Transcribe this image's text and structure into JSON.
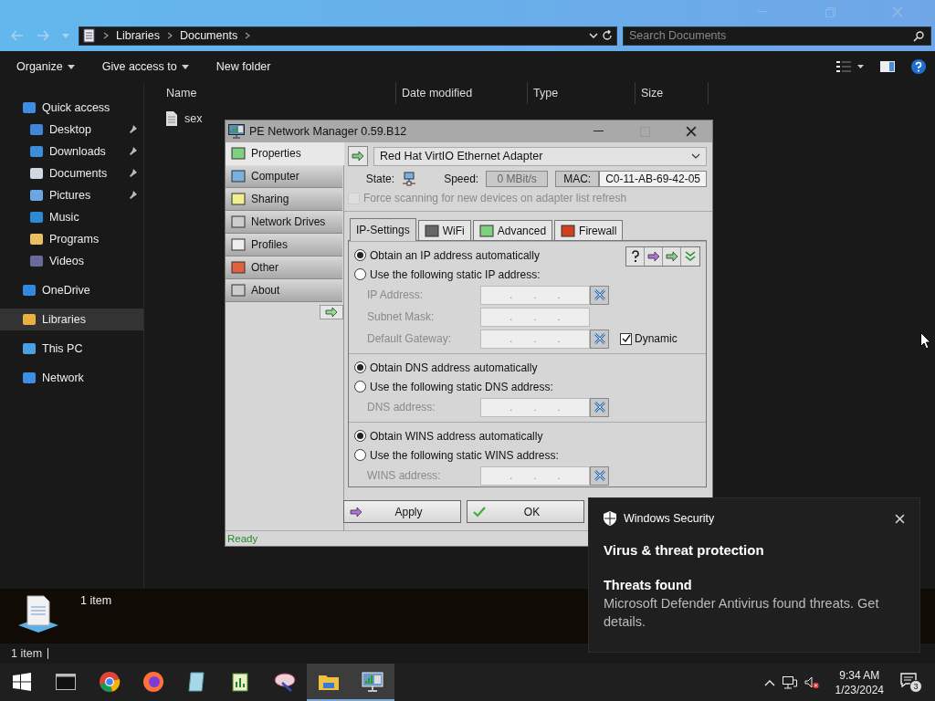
{
  "explorer": {
    "breadcrumb": [
      "Libraries",
      "Documents"
    ],
    "search": {
      "placeholder": "Search Documents"
    },
    "commands": [
      {
        "label": "Organize",
        "dropdown": true
      },
      {
        "label": "Give access to",
        "dropdown": true
      },
      {
        "label": "New folder",
        "dropdown": false
      }
    ],
    "nav_pane": [
      {
        "label": "Quick access",
        "selected": false,
        "children": [
          {
            "label": "Desktop",
            "selected": false,
            "pinned": true
          },
          {
            "label": "Downloads",
            "selected": false,
            "pinned": true
          },
          {
            "label": "Documents",
            "selected": false,
            "pinned": true
          },
          {
            "label": "Pictures",
            "selected": false,
            "pinned": true
          },
          {
            "label": "Music",
            "selected": false,
            "pinned": false
          },
          {
            "label": "Programs",
            "selected": false,
            "pinned": false
          },
          {
            "label": "Videos",
            "selected": false,
            "pinned": false
          }
        ]
      },
      {
        "label": "OneDrive",
        "selected": false
      },
      {
        "label": "Libraries",
        "selected": true
      },
      {
        "label": "This PC",
        "selected": false
      },
      {
        "label": "Network",
        "selected": false
      }
    ],
    "columns": [
      "Name",
      "Date modified",
      "Type",
      "Size"
    ],
    "files": [
      {
        "name": "sex"
      }
    ],
    "details": {
      "count": "1 item"
    },
    "status_bar": "1 item"
  },
  "dialog": {
    "title": "PE Network Manager 0.59.B12",
    "sidebar": [
      {
        "label": "Properties",
        "selected": true
      },
      {
        "label": "Computer",
        "selected": false
      },
      {
        "label": "Sharing",
        "selected": false
      },
      {
        "label": "Network Drives",
        "selected": false
      },
      {
        "label": "Profiles",
        "selected": false
      },
      {
        "label": "Other",
        "selected": false
      },
      {
        "label": "About",
        "selected": false
      }
    ],
    "adapter": "Red Hat VirtIO Ethernet Adapter",
    "state_label": "State:",
    "speed_label": "Speed:",
    "speed": "0 MBit/s",
    "mac_label": "MAC:",
    "mac": "C0-11-AB-69-42-05",
    "force_scan": {
      "label": "Force scanning for new devices on adapter list refresh",
      "checked": false,
      "disabled": true
    },
    "tabs": [
      {
        "label": "IP-Settings",
        "selected": true
      },
      {
        "label": "WiFi",
        "selected": false
      },
      {
        "label": "Advanced",
        "selected": false
      },
      {
        "label": "Firewall",
        "selected": false
      }
    ],
    "sections": [
      {
        "options": [
          {
            "label": "Obtain an IP address automatically",
            "selected": true
          },
          {
            "label": "Use the following static IP address:",
            "selected": false
          }
        ],
        "fields": [
          {
            "label": "IP Address:",
            "value": ". . .",
            "clear_button": true
          },
          {
            "label": "Subnet Mask:",
            "value": ". . .",
            "clear_button": false
          },
          {
            "label": "Default Gateway:",
            "value": ". . .",
            "clear_button": true,
            "checkbox": {
              "label": "Dynamic",
              "checked": true
            }
          }
        ]
      },
      {
        "options": [
          {
            "label": "Obtain DNS address automatically",
            "selected": true
          },
          {
            "label": "Use the following static DNS address:",
            "selected": false
          }
        ],
        "fields": [
          {
            "label": "DNS address:",
            "value": ". . .",
            "clear_button": true
          }
        ]
      },
      {
        "options": [
          {
            "label": "Obtain WINS address automatically",
            "selected": true
          },
          {
            "label": "Use the following static WINS address:",
            "selected": false
          }
        ],
        "fields": [
          {
            "label": "WINS address:",
            "value": ". . .",
            "clear_button": true
          }
        ]
      }
    ],
    "buttons": [
      "Apply",
      "OK"
    ],
    "status": "Ready"
  },
  "toast": {
    "app": "Windows Security",
    "title": "Virus & threat protection",
    "heading": "Threats found",
    "body": "Microsoft Defender Antivirus found threats. Get details."
  },
  "taskbar": {
    "apps": [
      {
        "active": false
      },
      {
        "active": false
      },
      {
        "active": false
      },
      {
        "active": false
      },
      {
        "active": false
      },
      {
        "active": false
      },
      {
        "active": true
      },
      {
        "active": true
      }
    ],
    "time": "9:34 AM",
    "date": "1/23/2024",
    "notifications": "3"
  }
}
